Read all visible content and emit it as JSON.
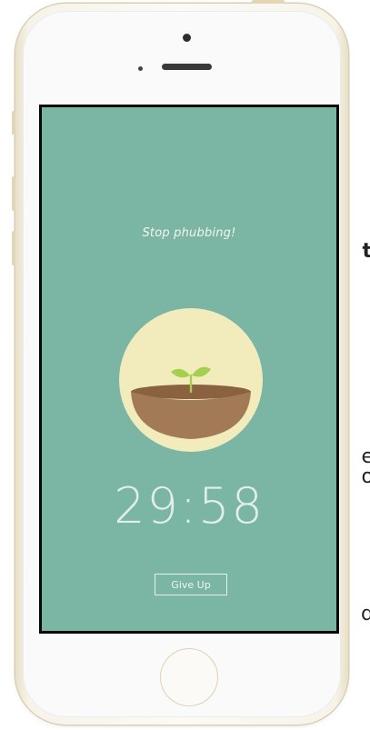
{
  "background_fragments": {
    "t": "t",
    "e": "e",
    "o": "o",
    "d": "d"
  },
  "app": {
    "subtitle": "Stop phubbing!",
    "timer": "29:58",
    "give_up_label": "Give Up"
  },
  "colors": {
    "screen_bg": "#7bb6a4",
    "circle_bg": "#f2ecbc",
    "pot_bg": "#a37a56",
    "sprout": "#a5cf4f"
  },
  "icons": {
    "plant": "sprout-in-pot-icon"
  }
}
